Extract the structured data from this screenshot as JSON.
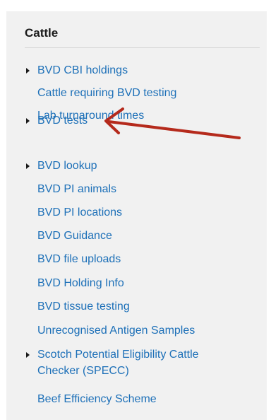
{
  "panel": {
    "title": "Cattle",
    "items": [
      {
        "label": "BVD CBI holdings",
        "expandable": true
      },
      {
        "label": "Cattle requiring BVD testing",
        "expandable": false
      },
      {
        "label": "Lab turnaround times",
        "expandable": false
      },
      {
        "label": "BVD tests",
        "expandable": true
      },
      {
        "label": "BVD lookup",
        "expandable": true
      },
      {
        "label": "BVD PI animals",
        "expandable": false
      },
      {
        "label": "BVD PI locations",
        "expandable": false
      },
      {
        "label": "BVD Guidance",
        "expandable": false
      },
      {
        "label": "BVD file uploads",
        "expandable": false
      },
      {
        "label": "BVD Holding Info",
        "expandable": false
      },
      {
        "label": "BVD tissue testing",
        "expandable": false
      },
      {
        "label": "Unrecognised Antigen Samples",
        "expandable": false
      },
      {
        "label": "Scotch Potential Eligibility Cattle",
        "label_line2": "Checker (SPECC)",
        "expandable": true
      },
      {
        "label": "Beef Efficiency Scheme",
        "expandable": false
      }
    ]
  },
  "colors": {
    "link": "#1d70b8",
    "panel_bg": "#f1f1f1",
    "annotation_arrow": "#b52a1c"
  },
  "annotation": {
    "icon": "red-arrow-icon",
    "points_to": "BVD tests"
  }
}
